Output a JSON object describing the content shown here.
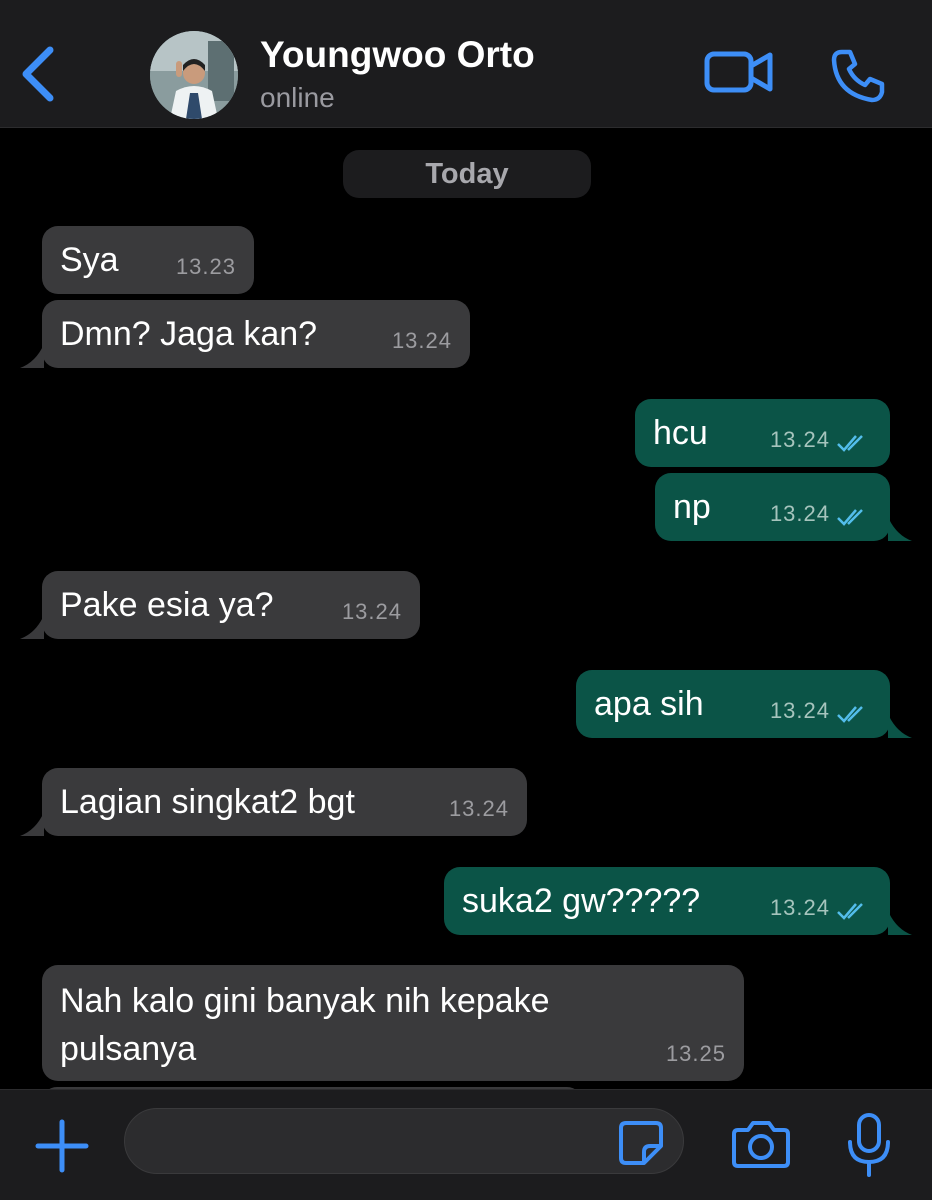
{
  "header": {
    "contact_name": "Youngwoo Orto",
    "status": "online"
  },
  "chat": {
    "date_label": "Today",
    "messages": [
      {
        "direction": "in",
        "text": "Sya",
        "time": "13.23"
      },
      {
        "direction": "in",
        "text": "Dmn? Jaga kan?",
        "time": "13.24"
      },
      {
        "direction": "out",
        "text": "hcu",
        "time": "13.24",
        "status": "read"
      },
      {
        "direction": "out",
        "text": "np",
        "time": "13.24",
        "status": "read"
      },
      {
        "direction": "in",
        "text": "Pake esia ya?",
        "time": "13.24"
      },
      {
        "direction": "out",
        "text": "apa sih",
        "time": "13.24",
        "status": "read"
      },
      {
        "direction": "in",
        "text": "Lagian singkat2 bgt",
        "time": "13.24"
      },
      {
        "direction": "out",
        "text": "suka2 gw?????",
        "time": "13.24",
        "status": "read"
      },
      {
        "direction": "in",
        "text": "Nah kalo gini banyak nih kepake pulsanya",
        "time": "13.25"
      }
    ]
  },
  "input": {
    "value": "",
    "placeholder": ""
  },
  "icons": {
    "back": "chevron-left-icon",
    "video_call": "video-camera-icon",
    "voice_call": "phone-icon",
    "attach": "plus-icon",
    "sticker": "sticker-icon",
    "camera": "camera-icon",
    "voice_note": "microphone-icon",
    "read_receipt": "double-check-icon"
  },
  "colors": {
    "accent": "#3d8ef7",
    "incoming_bubble": "#3a3a3c",
    "outgoing_bubble": "#0b5447",
    "read_ticks": "#53bdeb",
    "background": "#000000",
    "bar": "#1c1c1e"
  }
}
